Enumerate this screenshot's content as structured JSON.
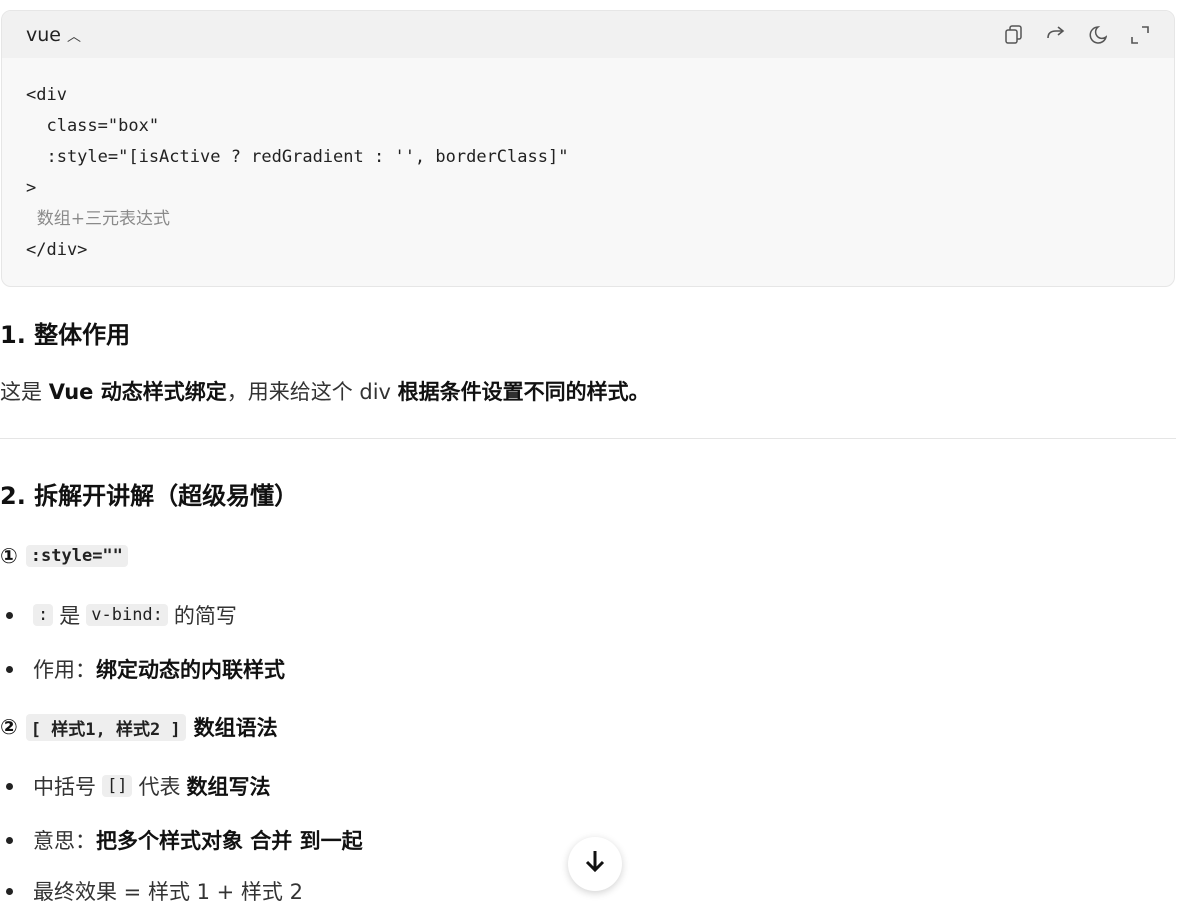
{
  "code": {
    "lang": "vue",
    "lines": [
      "<div",
      "  class=\"box\"",
      "  :style=\"[isActive ? redGradient : '', borderClass]\"",
      ">",
      "  数组+三元表达式",
      "</div>"
    ]
  },
  "section1": {
    "heading": "1. 整体作用",
    "p_pre": "这是 ",
    "p_b1": "Vue 动态样式绑定",
    "p_mid": "，用来给这个 div ",
    "p_b2": "根据条件设置不同的样式。"
  },
  "section2": {
    "heading": "2. 拆解开讲解（超级易懂）",
    "sub1": {
      "num": "①",
      "code": ":style=\"\""
    },
    "b1": {
      "code1": ":",
      "text1": "是",
      "code2": "v-bind:",
      "text2": "的简写"
    },
    "b2": {
      "text": "作用：",
      "bold": "绑定动态的内联样式"
    },
    "sub2": {
      "num": "②",
      "code": "[ 样式1, 样式2 ]",
      "text": "数组语法"
    },
    "b3": {
      "text1": "中括号",
      "code": "[]",
      "text2": "代表",
      "bold": "数组写法"
    },
    "b4": {
      "text": "意思：",
      "bold": "把多个样式对象 合并 到一起"
    },
    "b5": {
      "text": "最终效果 = 样式 1 + 样式 2"
    }
  }
}
